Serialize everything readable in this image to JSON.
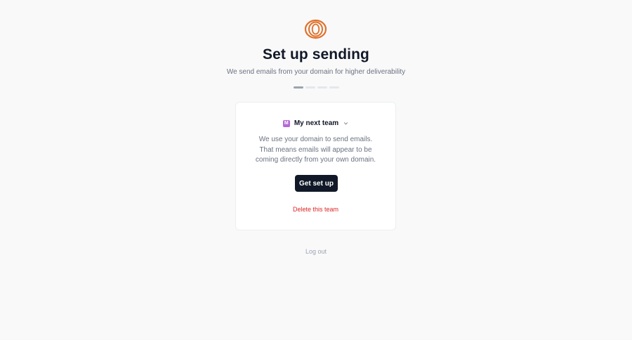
{
  "header": {
    "title": "Set up sending",
    "subtitle": "We send emails from your domain for higher deliverability",
    "logo_icon": "concentric-rings-logo",
    "logo_color": "#e0712a"
  },
  "progress": {
    "total_steps": 4,
    "current_step": 1
  },
  "card": {
    "team": {
      "initial": "M",
      "name": "My next team",
      "avatar_color": "#b36ad6",
      "dropdown_icon": "chevron-down-icon"
    },
    "description_lines": [
      "We use your domain to send emails.",
      "That means emails will appear to be",
      "coming directly from your own domain."
    ],
    "primary_button": "Get set up",
    "delete_link": "Delete this team",
    "delete_color": "#dc2626"
  },
  "footer": {
    "logout_label": "Log out"
  }
}
